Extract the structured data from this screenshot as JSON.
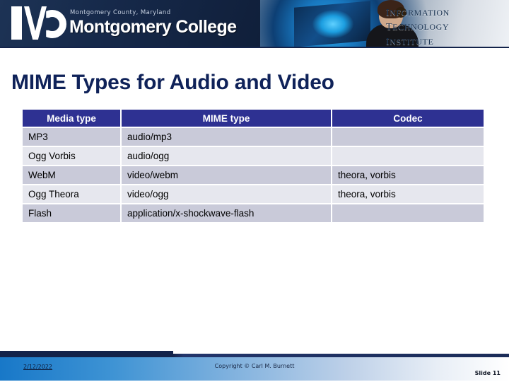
{
  "banner": {
    "logo_county": "Montgomery County, Maryland",
    "logo_college": "Montgomery College",
    "logo_mark_alt": "MC",
    "institute_line1": "Information",
    "institute_line2": "Technology",
    "institute_line3": "Institute"
  },
  "slide": {
    "title": "MIME Types for Audio and Video"
  },
  "table": {
    "headers": {
      "media": "Media type",
      "mime": "MIME type",
      "codec": "Codec"
    },
    "rows": [
      {
        "media": "MP3",
        "mime": "audio/mp3",
        "codec": ""
      },
      {
        "media": "Ogg Vorbis",
        "mime": "audio/ogg",
        "codec": ""
      },
      {
        "media": "WebM",
        "mime": "video/webm",
        "codec": "theora, vorbis"
      },
      {
        "media": "Ogg Theora",
        "mime": "video/ogg",
        "codec": "theora, vorbis"
      },
      {
        "media": "Flash",
        "mime": "application/x-shockwave-flash",
        "codec": ""
      }
    ]
  },
  "footer": {
    "date": "2/12/2022",
    "copyright": "Copyright © Carl M. Burnett",
    "slide_number": "Slide 11"
  },
  "colors": {
    "title": "#0f2259",
    "table_header_bg": "#2e3192",
    "row_odd_bg": "#c9cad9",
    "row_even_bg": "#e6e7ee",
    "banner_navy": "#13234a",
    "footer_blue": "#1878c8"
  }
}
